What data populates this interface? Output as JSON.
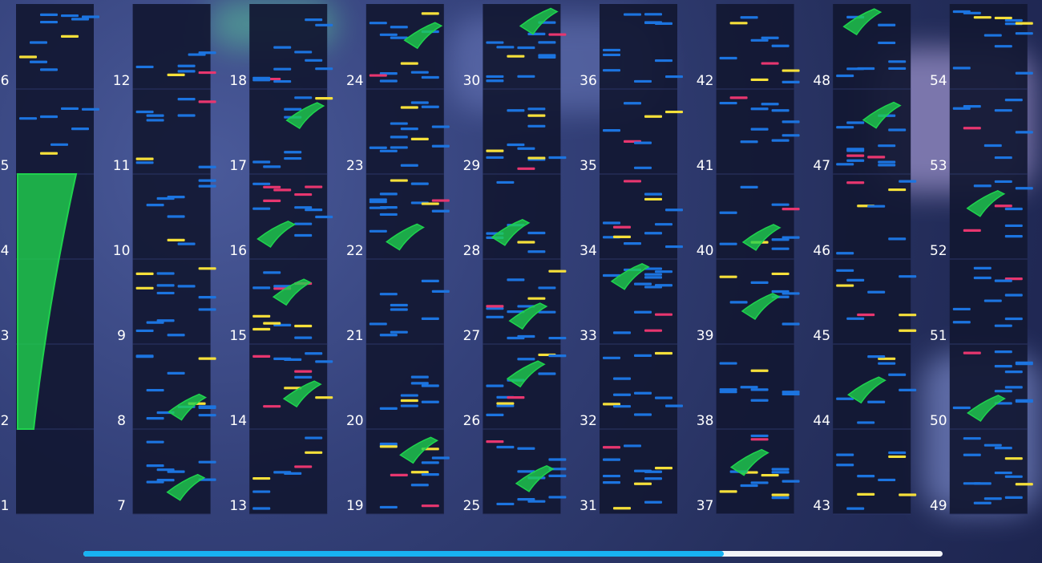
{
  "chart_type": "rhythm-game-chart-overview",
  "measures_per_column": 6,
  "column_count": 9,
  "measure_start": 1,
  "measure_end": 54,
  "playback_progress": 0.745,
  "colors": {
    "tap_note": "#1c74e0",
    "flick_note": "#e8366f",
    "double_note": "#f6e03a",
    "slide_fill": "#1fd24e",
    "lane_bg": "#121833",
    "progress_fill": "#18b2f2",
    "progress_track": "#f2f4f8",
    "label": "#ffffff"
  },
  "note_types": [
    "tap",
    "flick",
    "double",
    "slide",
    "long"
  ]
}
